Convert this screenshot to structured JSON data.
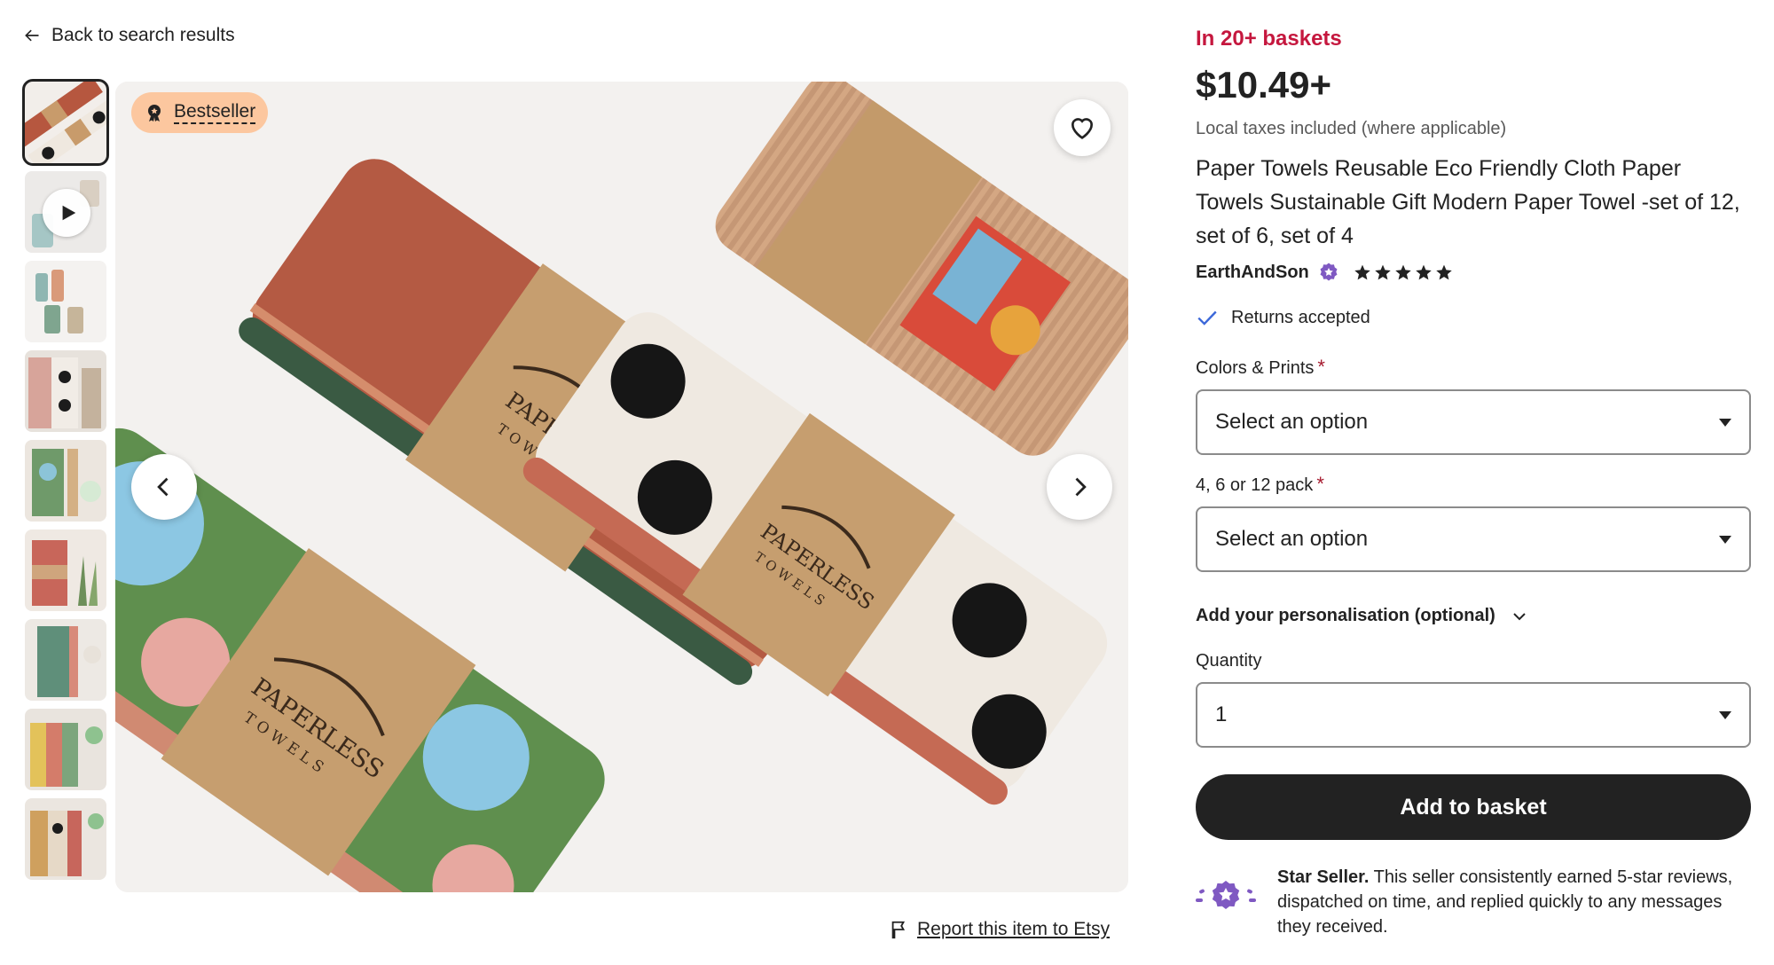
{
  "nav": {
    "back_label": "Back to search results"
  },
  "gallery": {
    "thumbnail_count": 9,
    "bestseller_label": "Bestseller",
    "report_label": "Report this item to Etsy"
  },
  "product": {
    "baskets": "In 20+ baskets",
    "price": "$10.49+",
    "taxes": "Local taxes included (where applicable)",
    "title": "Paper Towels Reusable Eco Friendly Cloth Paper Towels Sustainable Gift Modern Paper Towel -set of 12, set of 6, set of 4",
    "shop_name": "EarthAndSon",
    "rating_stars": 5,
    "returns": "Returns accepted"
  },
  "options": {
    "colors_label": "Colors & Prints",
    "colors_value": "Select an option",
    "pack_label": "4, 6 or 12 pack",
    "pack_value": "Select an option",
    "required_mark": "*",
    "personalisation_label": "Add your personalisation (optional)",
    "quantity_label": "Quantity",
    "quantity_value": "1",
    "add_to_basket": "Add to basket"
  },
  "star_seller": {
    "heading": "Star Seller.",
    "text": " This seller consistently earned 5-star reviews, dispatched on time, and replied quickly to any messages they received."
  },
  "colors": {
    "baskets_red": "#c5173e",
    "bestseller_bg": "#fcc79f",
    "button_dark": "#222222",
    "check_blue": "#3b67d9",
    "star_seller_purple": "#7f59c2"
  }
}
